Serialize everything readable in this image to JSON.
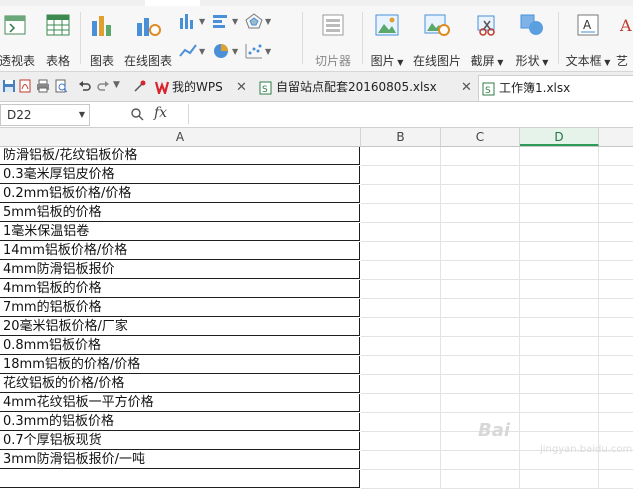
{
  "ribbon": {
    "pivot_table": "透视表",
    "table": "表格",
    "chart": "图表",
    "online_chart": "在线图表",
    "slicer": "切片器",
    "picture": "图片",
    "online_picture": "在线图片",
    "screenshot": "截屏",
    "shapes": "形状",
    "textbox": "文本框",
    "art_text": "艺"
  },
  "doc_tabs": [
    {
      "label": "我的WPS"
    },
    {
      "label": "自留站点配套20160805.xlsx"
    },
    {
      "label": "工作簿1.xlsx"
    }
  ],
  "formula_bar": {
    "name_box": "D22",
    "fx": "fx",
    "content": ""
  },
  "columns": [
    "A",
    "B",
    "C",
    "D"
  ],
  "selected_column": "D",
  "cells": [
    "防滑铝板/花纹铝板价格",
    "0.3毫米厚铝皮价格",
    "0.2mm铝板价格/价格",
    "5mm铝板的价格",
    "1毫米保温铝卷",
    "14mm铝板价格/价格",
    "4mm防滑铝板报价",
    "4mm铝板的价格",
    "7mm的铝板价格",
    "20毫米铝板价格/厂家",
    "0.8mm铝板价格",
    "18mm铝板的价格/价格",
    "花纹铝板的价格/价格",
    "4mm花纹铝板一平方价格",
    "0.3mm的铝板价格",
    "0.7个厚铝板现货",
    "3mm防滑铝板报价/一吨",
    ""
  ],
  "watermark": {
    "text": "Bai",
    "sub": "jingyan.baidu.com"
  },
  "colors": {
    "accent": "#2f9a58",
    "wps_red": "#d9232d"
  }
}
